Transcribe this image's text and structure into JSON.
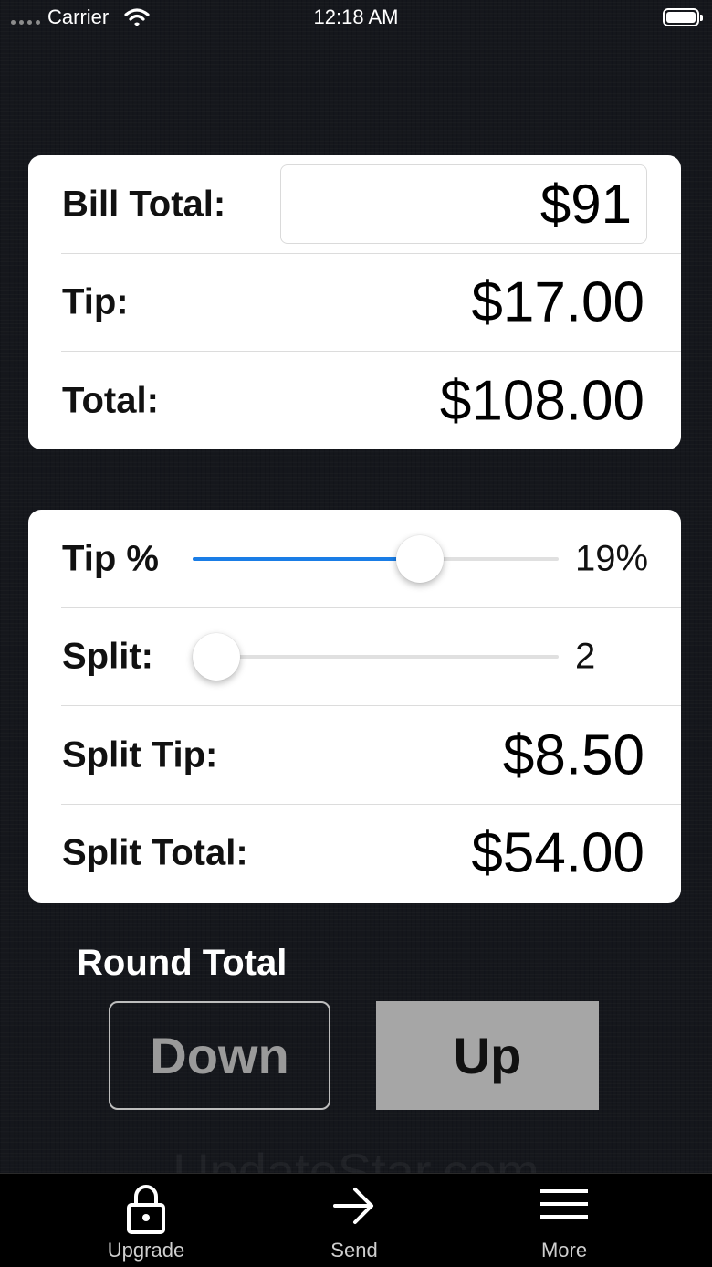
{
  "status_bar": {
    "carrier": "Carrier",
    "time": "12:18 AM"
  },
  "bill_card": {
    "bill_label": "Bill Total:",
    "bill_value": "$91",
    "tip_label": "Tip:",
    "tip_value": "$17.00",
    "total_label": "Total:",
    "total_value": "$108.00"
  },
  "split_card": {
    "tip_pct_label": "Tip %",
    "tip_pct_value": "19%",
    "tip_pct_slider_fraction": 0.62,
    "split_label": "Split:",
    "split_value": "2",
    "split_slider_fraction": 0.01,
    "split_tip_label": "Split Tip:",
    "split_tip_value": "$8.50",
    "split_total_label": "Split Total:",
    "split_total_value": "$54.00"
  },
  "round": {
    "label": "Round Total",
    "down_label": "Down",
    "up_label": "Up"
  },
  "watermark": "UpdateStar.com",
  "tab_bar": {
    "items": [
      {
        "label": "Upgrade",
        "icon": "lock-icon"
      },
      {
        "label": "Send",
        "icon": "arrow-right-icon"
      },
      {
        "label": "More",
        "icon": "menu-icon"
      }
    ]
  },
  "colors": {
    "accent": "#1a7de6",
    "background": "#15171c",
    "card": "#ffffff",
    "up_button": "#a6a6a6"
  }
}
